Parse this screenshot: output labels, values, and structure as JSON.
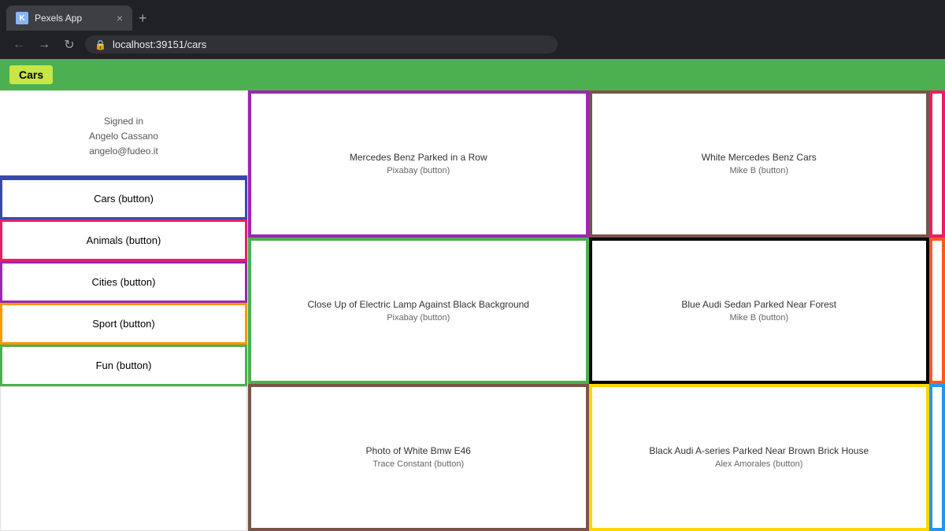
{
  "browser": {
    "tab_title": "Pexels App",
    "tab_icon": "K",
    "close_label": "×",
    "new_tab_label": "+",
    "nav_back": "←",
    "nav_forward": "→",
    "nav_refresh": "↻",
    "url_icon": "🔒",
    "url": "localhost:39151/cars"
  },
  "header": {
    "badge_label": "Cars"
  },
  "sidebar": {
    "signed_in_label": "Signed in",
    "user_name": "Angelo Cassano",
    "user_email": "angelo@fudeo.it",
    "nav_items": [
      {
        "label": "Cars (button)",
        "class": "nav-btn-cars"
      },
      {
        "label": "Animals (button)",
        "class": "nav-btn-animals"
      },
      {
        "label": "Cities (button)",
        "class": "nav-btn-cities"
      },
      {
        "label": "Sport (button)",
        "class": "nav-btn-sport"
      },
      {
        "label": "Fun (button)",
        "class": "nav-btn-fun"
      }
    ]
  },
  "photos": [
    {
      "title": "Mercedes Benz Parked in a Row",
      "author": "Pixabay (button)",
      "border_class": "photo-card-1"
    },
    {
      "title": "White Mercedes Benz Cars",
      "author": "Mike B (button)",
      "border_class": "photo-card-2"
    },
    {
      "title": "Close Up of Electric Lamp Against Black Background",
      "author": "Pixabay (button)",
      "border_class": "photo-card-3"
    },
    {
      "title": "Blue Audi Sedan Parked Near Forest",
      "author": "Mike B (button)",
      "border_class": "photo-card-4"
    },
    {
      "title": "Photo of White Bmw E46",
      "author": "Trace Constant (button)",
      "border_class": "photo-card-5"
    },
    {
      "title": "Black Audi A-series Parked Near Brown Brick House",
      "author": "Alex Amorales (button)",
      "border_class": "photo-card-6"
    }
  ]
}
